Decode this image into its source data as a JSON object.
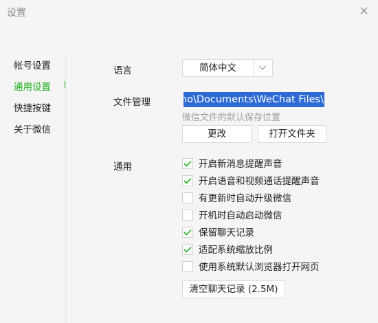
{
  "window": {
    "title": "设置"
  },
  "sidebar": {
    "items": [
      {
        "label": "帐号设置",
        "active": false
      },
      {
        "label": "通用设置",
        "active": true
      },
      {
        "label": "快捷按键",
        "active": false
      },
      {
        "label": "关于微信",
        "active": false
      }
    ]
  },
  "language": {
    "label": "语言",
    "selected": "简体中文"
  },
  "file_management": {
    "label": "文件管理",
    "path_value": "mo\\Documents\\WeChat Files\\",
    "hint": "微信文件的默认保存位置",
    "change_button": "更改",
    "open_folder_button": "打开文件夹"
  },
  "general": {
    "label": "通用",
    "options": [
      {
        "label": "开启新消息提醒声音",
        "checked": true
      },
      {
        "label": "开启语音和视频通话提醒声音",
        "checked": true
      },
      {
        "label": "有更新时自动升级微信",
        "checked": false
      },
      {
        "label": "开机时自动启动微信",
        "checked": false
      },
      {
        "label": "保留聊天记录",
        "checked": true
      },
      {
        "label": "适配系统缩放比例",
        "checked": true
      },
      {
        "label": "使用系统默认浏览器打开网页",
        "checked": false
      }
    ],
    "clear_button": "清空聊天记录 (2.5M)"
  },
  "colors": {
    "accent": "#1aad19",
    "selection": "#2d6ad4"
  },
  "icons": {
    "close": "close-icon",
    "dropdown": "chevron-down-icon",
    "check": "check-icon"
  }
}
